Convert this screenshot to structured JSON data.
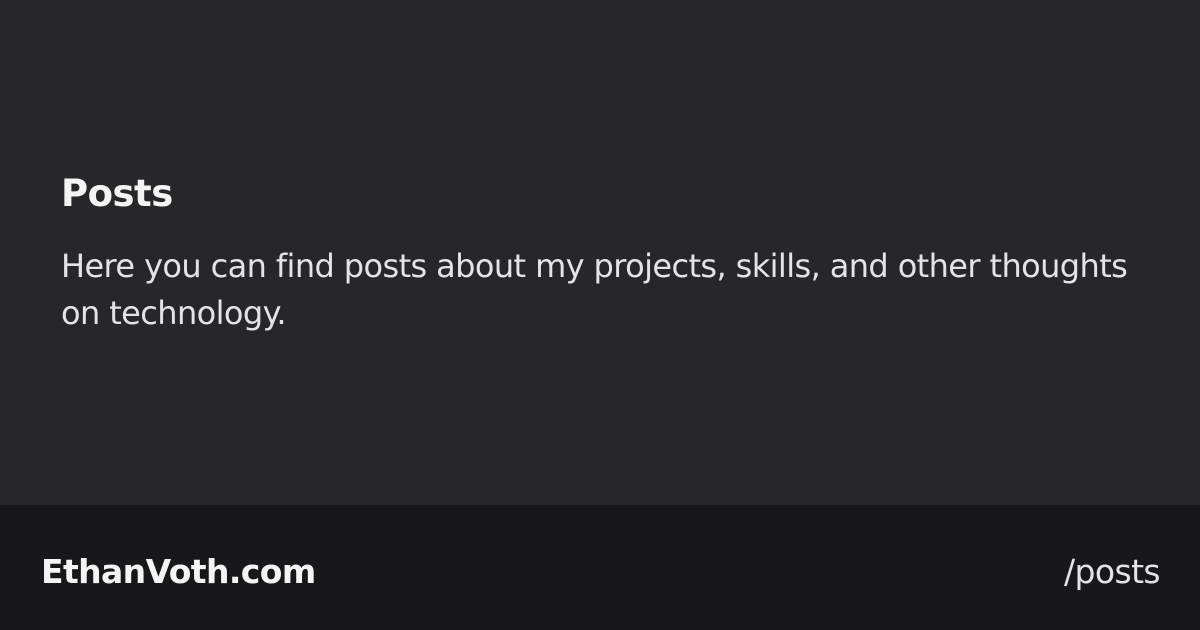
{
  "main": {
    "title": "Posts",
    "description": "Here you can find posts about my projects, skills, and other thoughts on technology."
  },
  "footer": {
    "site_name": "EthanVoth.com",
    "path": "/posts"
  },
  "colors": {
    "background": "#27272a",
    "footer_background": "#18181b"
  }
}
